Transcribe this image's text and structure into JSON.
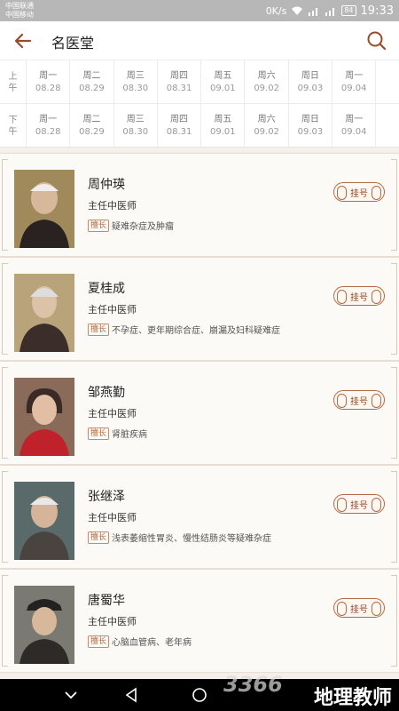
{
  "status": {
    "carrier1": "中国联通",
    "carrier2": "中国移动",
    "speed": "0K/s",
    "battery": "84",
    "time": "19:33"
  },
  "header": {
    "title": "名医堂"
  },
  "schedule": {
    "am_label": [
      "上",
      "午"
    ],
    "pm_label": [
      "下",
      "午"
    ],
    "days": [
      {
        "weekday": "周一",
        "date": "08.28"
      },
      {
        "weekday": "周二",
        "date": "08.29"
      },
      {
        "weekday": "周三",
        "date": "08.30"
      },
      {
        "weekday": "周四",
        "date": "08.31"
      },
      {
        "weekday": "周五",
        "date": "09.01"
      },
      {
        "weekday": "周六",
        "date": "09.02"
      },
      {
        "weekday": "周日",
        "date": "09.03"
      },
      {
        "weekday": "周一",
        "date": "09.04"
      }
    ]
  },
  "doctors": [
    {
      "name": "周仲瑛",
      "title": "主任中医师",
      "spec_label": "擅长",
      "specialty": "疑难杂症及肿瘤",
      "register": "挂号"
    },
    {
      "name": "夏桂成",
      "title": "主任中医师",
      "spec_label": "擅长",
      "specialty": "不孕症、更年期综合症、崩漏及妇科疑难症",
      "register": "挂号"
    },
    {
      "name": "邹燕勤",
      "title": "主任中医师",
      "spec_label": "擅长",
      "specialty": "肾脏疾病",
      "register": "挂号"
    },
    {
      "name": "张继泽",
      "title": "主任中医师",
      "spec_label": "擅长",
      "specialty": "浅表萎缩性胃炎、慢性结肠炎等疑难杂症",
      "register": "挂号"
    },
    {
      "name": "唐蜀华",
      "title": "主任中医师",
      "spec_label": "擅长",
      "specialty": "心脑血管病、老年病",
      "register": "挂号"
    }
  ],
  "watermark": {
    "logo": "3366",
    "text": "地理教师",
    "small": "手游网"
  }
}
